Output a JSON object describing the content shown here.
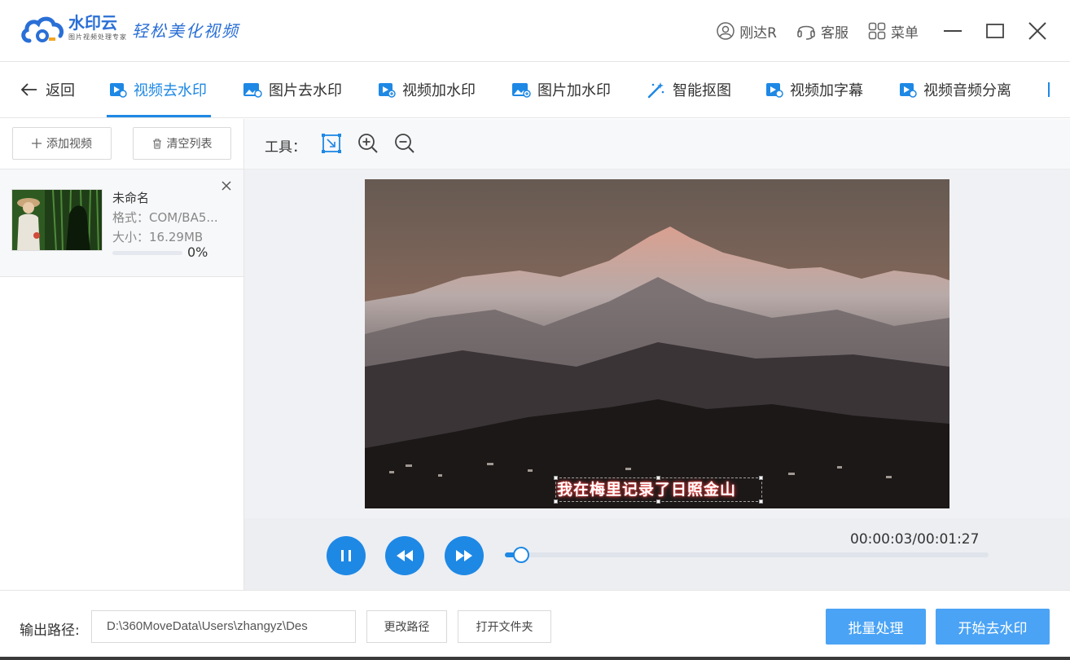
{
  "app": {
    "brand_name": "水印云",
    "brand_sub": "图片视频处理专家",
    "slogan": "轻松美化视频"
  },
  "titlebar": {
    "user": "刚达R",
    "service": "客服",
    "menu": "菜单"
  },
  "tabs": {
    "back": "返回",
    "items": [
      "视频去水印",
      "图片去水印",
      "视频加水印",
      "图片加水印",
      "智能抠图",
      "视频加字幕",
      "视频音频分离"
    ],
    "active_index": 0
  },
  "left": {
    "add_video": "添加视频",
    "clear_list": "清空列表",
    "file": {
      "name": "未命名",
      "format": "格式：COM/BA5...",
      "size": "大小：16.29MB",
      "progress": 0,
      "progress_text": "0%"
    }
  },
  "toolbar": {
    "label": "工具："
  },
  "player": {
    "subtitle": "我在梅里记录了日照金山",
    "time": "00:00:03/00:01:27",
    "progress_fraction": 0.034
  },
  "bottom": {
    "output_label": "输出路径:",
    "output_path": "D:\\360MoveData\\Users\\zhangyz\\Des",
    "change_path": "更改路径",
    "open_folder": "打开文件夹",
    "batch": "批量处理",
    "start": "开始去水印"
  },
  "colors": {
    "accent": "#1e88e5",
    "primary_button": "#4aa3f5"
  }
}
